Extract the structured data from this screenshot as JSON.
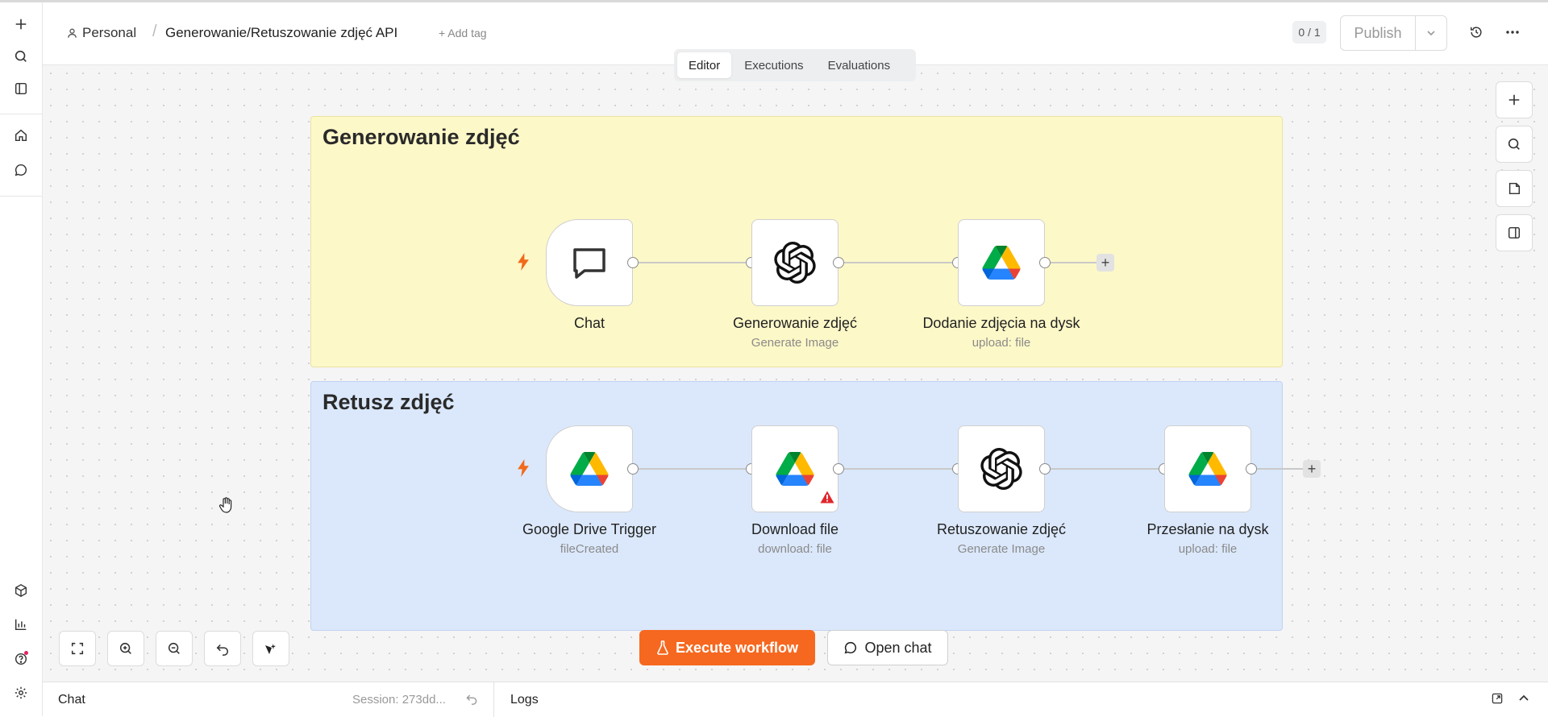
{
  "header": {
    "project": "Personal",
    "workflow_title": "Generowanie/Retuszowanie zdjęć API",
    "add_tag": "+ Add tag",
    "counter": "0 / 1",
    "publish_label": "Publish"
  },
  "tabs": [
    {
      "label": "Editor",
      "active": true
    },
    {
      "label": "Executions",
      "active": false
    },
    {
      "label": "Evaluations",
      "active": false
    }
  ],
  "sticky_notes": [
    {
      "title": "Generowanie zdjęć",
      "color": "#fdf8c8"
    },
    {
      "title": "Retusz zdjęć",
      "color": "#dbe8fb"
    }
  ],
  "nodes": {
    "chat": {
      "label": "Chat",
      "sub": "",
      "icon": "chat-bubble-icon"
    },
    "gen": {
      "label": "Generowanie zdjęć",
      "sub": "Generate Image",
      "icon": "openai-icon"
    },
    "dodanie": {
      "label": "Dodanie zdjęcia na dysk",
      "sub": "upload: file",
      "icon": "google-drive-icon"
    },
    "gdtrigger": {
      "label": "Google Drive Trigger",
      "sub": "fileCreated",
      "icon": "google-drive-icon"
    },
    "download": {
      "label": "Download file",
      "sub": "download: file",
      "icon": "google-drive-icon"
    },
    "retusz": {
      "label": "Retuszowanie zdjęć",
      "sub": "Generate Image",
      "icon": "openai-icon"
    },
    "przeslanie": {
      "label": "Przesłanie na dysk",
      "sub": "upload: file",
      "icon": "google-drive-icon"
    }
  },
  "actions": {
    "execute": "Execute workflow",
    "open_chat": "Open chat"
  },
  "bottom": {
    "chat": "Chat",
    "session": "Session: 273dd...",
    "logs": "Logs"
  },
  "colors": {
    "accent": "#f6681f",
    "trigger_bolt": "#f26a1b",
    "warning": "#e0262c"
  }
}
